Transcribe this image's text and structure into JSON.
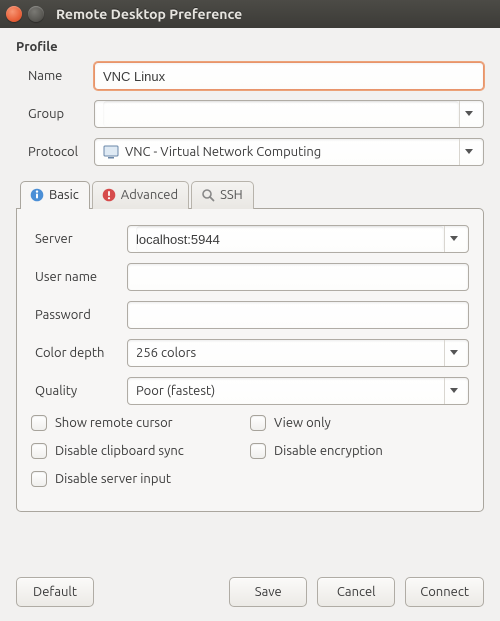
{
  "window": {
    "title": "Remote Desktop Preference"
  },
  "profile": {
    "heading": "Profile",
    "name_label": "Name",
    "name_value": "VNC Linux",
    "group_label": "Group",
    "group_value": "",
    "protocol_label": "Protocol",
    "protocol_value": "VNC - Virtual Network Computing"
  },
  "tabs": {
    "basic": "Basic",
    "advanced": "Advanced",
    "ssh": "SSH"
  },
  "basic": {
    "server_label": "Server",
    "server_value": "localhost:5944",
    "username_label": "User name",
    "username_value": "",
    "password_label": "Password",
    "password_value": "",
    "colordepth_label": "Color depth",
    "colordepth_value": "256 colors",
    "quality_label": "Quality",
    "quality_value": "Poor (fastest)",
    "show_remote_cursor": "Show remote cursor",
    "view_only": "View only",
    "disable_clipboard": "Disable clipboard sync",
    "disable_encryption": "Disable encryption",
    "disable_server_input": "Disable server input"
  },
  "buttons": {
    "default": "Default",
    "save": "Save",
    "cancel": "Cancel",
    "connect": "Connect"
  }
}
